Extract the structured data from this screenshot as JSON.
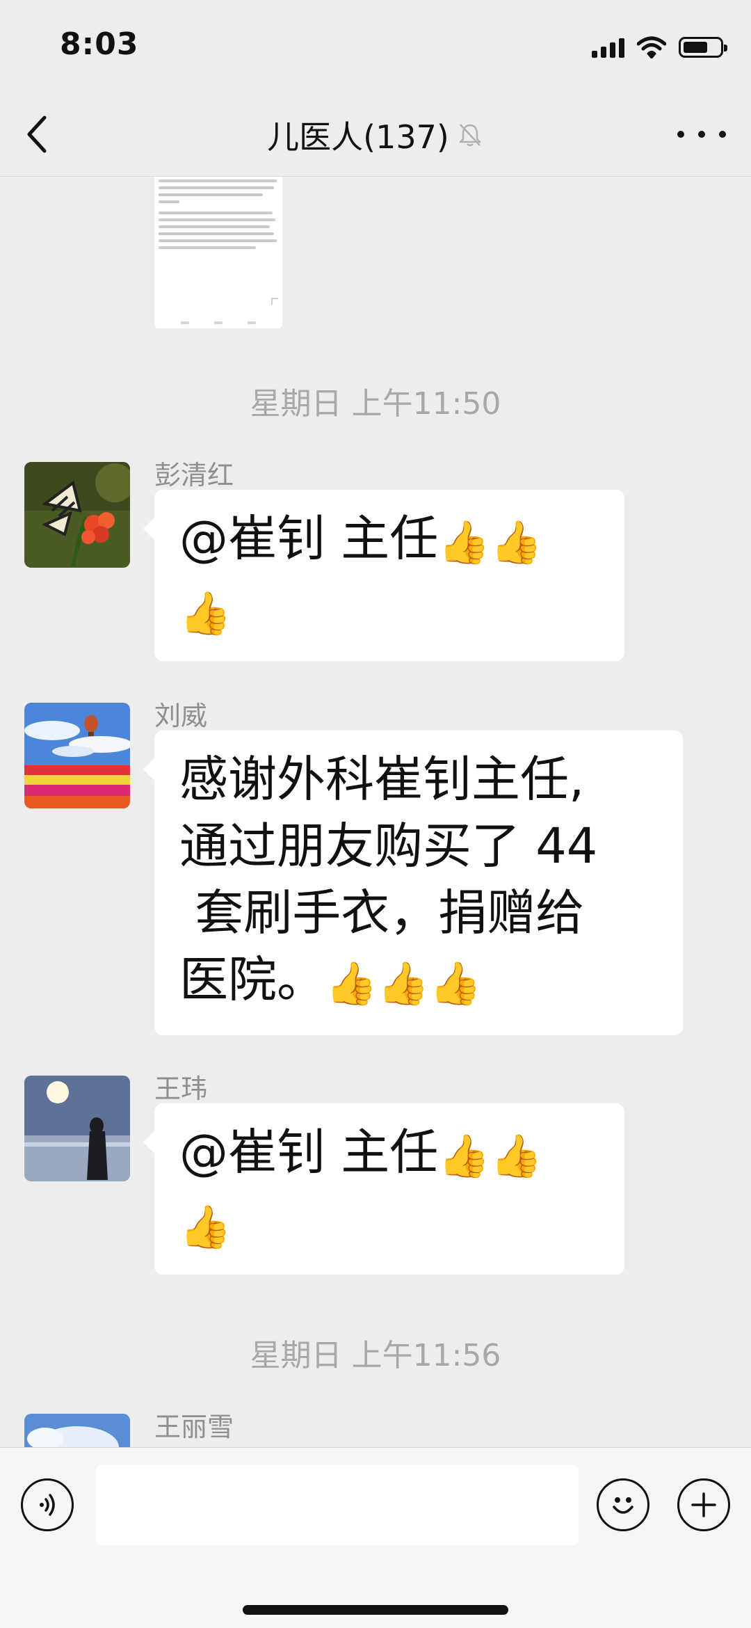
{
  "status_bar": {
    "time": "8:03",
    "battery_level": 0.65
  },
  "header": {
    "back_icon": "chevron-left-icon",
    "title": "儿医人(137)",
    "mute_icon": "bell-slash-icon",
    "more_icon": "more-dots-icon"
  },
  "messages": {
    "ts1": "星期日 上午11:50",
    "m1": {
      "sender": "彭清红",
      "line1": "@崔钊 主任",
      "avatar": "butterfly-avatar"
    },
    "m2": {
      "sender": "刘威",
      "lines": [
        "感谢外科崔钊主任,",
        "通过朋友购买了 44",
        " 套刷手衣，捐赠给",
        "医院。"
      ],
      "avatar": "tulip-field-avatar"
    },
    "m3": {
      "sender": "王玮",
      "line1": "@崔钊 主任",
      "avatar": "sunset-lake-avatar"
    },
    "ts2": "星期日 上午11:56",
    "m4": {
      "sender": "王丽雪",
      "avatar": "sky-avatar"
    }
  },
  "input_bar": {
    "voice_icon": "voice-icon",
    "input_value": "",
    "emoji_icon": "emoji-icon",
    "plus_icon": "plus-icon"
  },
  "colors": {
    "background": "#ededed",
    "bubble": "#ffffff",
    "timestamp": "#a8a8a8",
    "sender": "#8f8f8f"
  }
}
